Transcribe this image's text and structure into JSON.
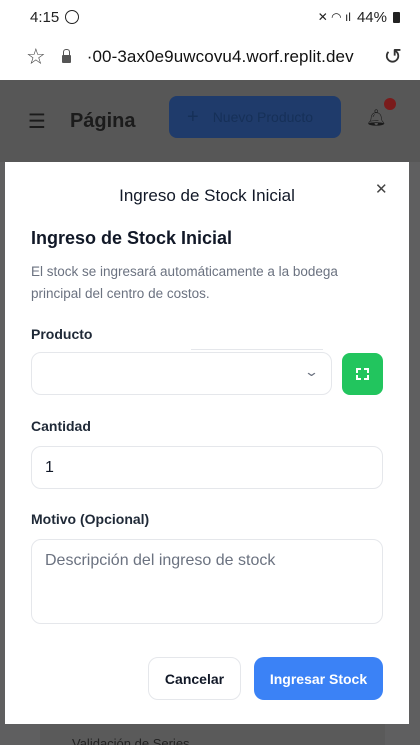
{
  "status_bar": {
    "time": "4:15",
    "battery": "44%"
  },
  "browser": {
    "url": "·00-3ax0e9uwcovu4.worf.replit.dev"
  },
  "app_header": {
    "title": "Página",
    "new_product_label": "Nuevo Producto"
  },
  "modal": {
    "title": "Ingreso de Stock Inicial",
    "section_title": "Ingreso de Stock Inicial",
    "description": "El stock se ingresará automáticamente a la bodega principal del centro de costos.",
    "product_label": "Producto",
    "product_value": "",
    "quantity_label": "Cantidad",
    "quantity_value": "1",
    "reason_label": "Motivo (Opcional)",
    "reason_placeholder": "Descripción del ingreso de stock",
    "cancel_label": "Cancelar",
    "submit_label": "Ingresar Stock"
  },
  "behind": {
    "card_title": "Validación de Series"
  },
  "colors": {
    "primary": "#3b82f6",
    "scan": "#22c55e",
    "overlay": "#5f5f60"
  },
  "icons": [
    "whatsapp-icon",
    "mute-icon",
    "wifi-icon",
    "signal-icon",
    "battery-icon",
    "star-icon",
    "lock-icon",
    "reload-icon",
    "menu-icon",
    "plus-icon",
    "bell-icon",
    "close-icon",
    "chevron-down-icon",
    "scan-icon"
  ]
}
